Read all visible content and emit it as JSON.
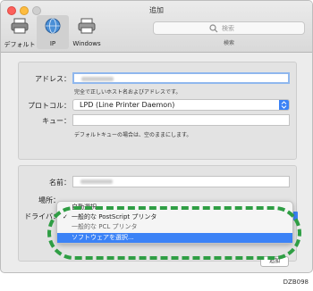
{
  "window": {
    "title": "追加"
  },
  "toolbar": {
    "items": [
      {
        "label": "デフォルト",
        "icon": "printer-default-icon"
      },
      {
        "label": "IP",
        "icon": "globe-icon"
      },
      {
        "label": "Windows",
        "icon": "windows-printer-icon"
      }
    ],
    "search_placeholder": "検索",
    "search_caption": "検索"
  },
  "form": {
    "address_label": "アドレス：",
    "address_hint": "完全で正しいホスト名およびアドレスです。",
    "protocol_label": "プロトコル：",
    "protocol_value": "LPD (Line Printer Daemon)",
    "queue_label": "キュー：",
    "queue_hint": "デフォルトキューの場合は、空のままにします。",
    "name_label": "名前：",
    "location_label": "場所：",
    "driver_label": "ドライバ："
  },
  "menu": {
    "items": [
      {
        "label": "自動選択",
        "checked": false
      },
      {
        "label": "一般的な PostScript プリンタ",
        "checked": true
      },
      {
        "label": "一般的な PCL プリンタ",
        "checked": false
      },
      {
        "label": "ソフトウェアを選択...",
        "checked": false,
        "selected": true
      }
    ]
  },
  "buttons": {
    "ok_label": "追加"
  },
  "figure_id": "DZB098",
  "colors": {
    "accent": "#3b82f6",
    "highlight": "#2f9e44"
  }
}
